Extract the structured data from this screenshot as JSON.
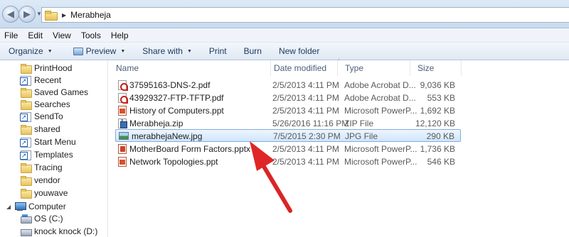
{
  "addressbar": {
    "back_icon": "back-arrow-icon",
    "forward_icon": "forward-arrow-icon",
    "crumb_separator": "▶",
    "path": "Merabheja"
  },
  "menubar": {
    "items": [
      "File",
      "Edit",
      "View",
      "Tools",
      "Help"
    ]
  },
  "toolbar": {
    "organize": "Organize",
    "preview": "Preview",
    "share_with": "Share with",
    "print": "Print",
    "burn": "Burn",
    "new_folder": "New folder"
  },
  "navpane": {
    "items": [
      {
        "label": "PrintHood",
        "icon": "folder-icon"
      },
      {
        "label": "Recent",
        "icon": "shortcut-icon"
      },
      {
        "label": "Saved Games",
        "icon": "folder-icon"
      },
      {
        "label": "Searches",
        "icon": "folder-icon"
      },
      {
        "label": "SendTo",
        "icon": "shortcut-icon"
      },
      {
        "label": "shared",
        "icon": "folder-icon"
      },
      {
        "label": "Start Menu",
        "icon": "shortcut-icon"
      },
      {
        "label": "Templates",
        "icon": "shortcut-icon"
      },
      {
        "label": "Tracing",
        "icon": "folder-icon"
      },
      {
        "label": "vendor",
        "icon": "folder-icon"
      },
      {
        "label": "youwave",
        "icon": "folder-icon"
      },
      {
        "label": "Computer",
        "icon": "computer-icon"
      },
      {
        "label": "OS (C:)",
        "icon": "drive-icon"
      },
      {
        "label": "knock knock (D:)",
        "icon": "cd-drive-icon"
      }
    ]
  },
  "columns": {
    "name": "Name",
    "date_modified": "Date modified",
    "type": "Type",
    "size": "Size"
  },
  "files": [
    {
      "name": "37595163-DNS-2.pdf",
      "date": "2/5/2013 4:11 PM",
      "type": "Adobe Acrobat D...",
      "size": "9,036 KB",
      "icon": "pdf"
    },
    {
      "name": "43929327-FTP-TFTP.pdf",
      "date": "2/5/2013 4:11 PM",
      "type": "Adobe Acrobat D...",
      "size": "553 KB",
      "icon": "pdf"
    },
    {
      "name": "History of Computers.ppt",
      "date": "2/5/2013 4:11 PM",
      "type": "Microsoft PowerP...",
      "size": "1,692 KB",
      "icon": "ppt"
    },
    {
      "name": "Merabheja.zip",
      "date": "5/26/2016 11:16 PM",
      "type": "ZIP File",
      "size": "12,120 KB",
      "icon": "zip"
    },
    {
      "name": "merabhejaNew.jpg",
      "date": "7/5/2015 2:30 PM",
      "type": "JPG File",
      "size": "290 KB",
      "icon": "jpg",
      "selected": true
    },
    {
      "name": "MotherBoard Form Factors.pptx",
      "date": "2/5/2013 4:11 PM",
      "type": "Microsoft PowerP...",
      "size": "1,736 KB",
      "icon": "pptx"
    },
    {
      "name": "Network Topologies.ppt",
      "date": "2/5/2013 4:11 PM",
      "type": "Microsoft PowerP...",
      "size": "546 KB",
      "icon": "ppt"
    }
  ],
  "colors": {
    "selection_border": "#84acdd",
    "annotation_arrow": "#e02626"
  }
}
